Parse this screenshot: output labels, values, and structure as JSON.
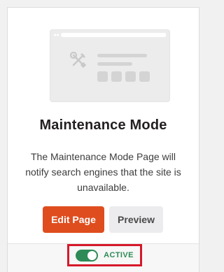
{
  "card": {
    "title": "Maintenance Mode",
    "description": "The Maintenance Mode Page will notify search engines that the site is unavailable.",
    "preview_icon": "wrench-screwdriver-icon"
  },
  "actions": {
    "edit_label": "Edit Page",
    "preview_label": "Preview"
  },
  "status": {
    "toggle_on": true,
    "label": "ACTIVE"
  },
  "colors": {
    "primary": "#df4d1e",
    "active_green": "#2e8b57",
    "highlight_red": "#d6192b"
  }
}
